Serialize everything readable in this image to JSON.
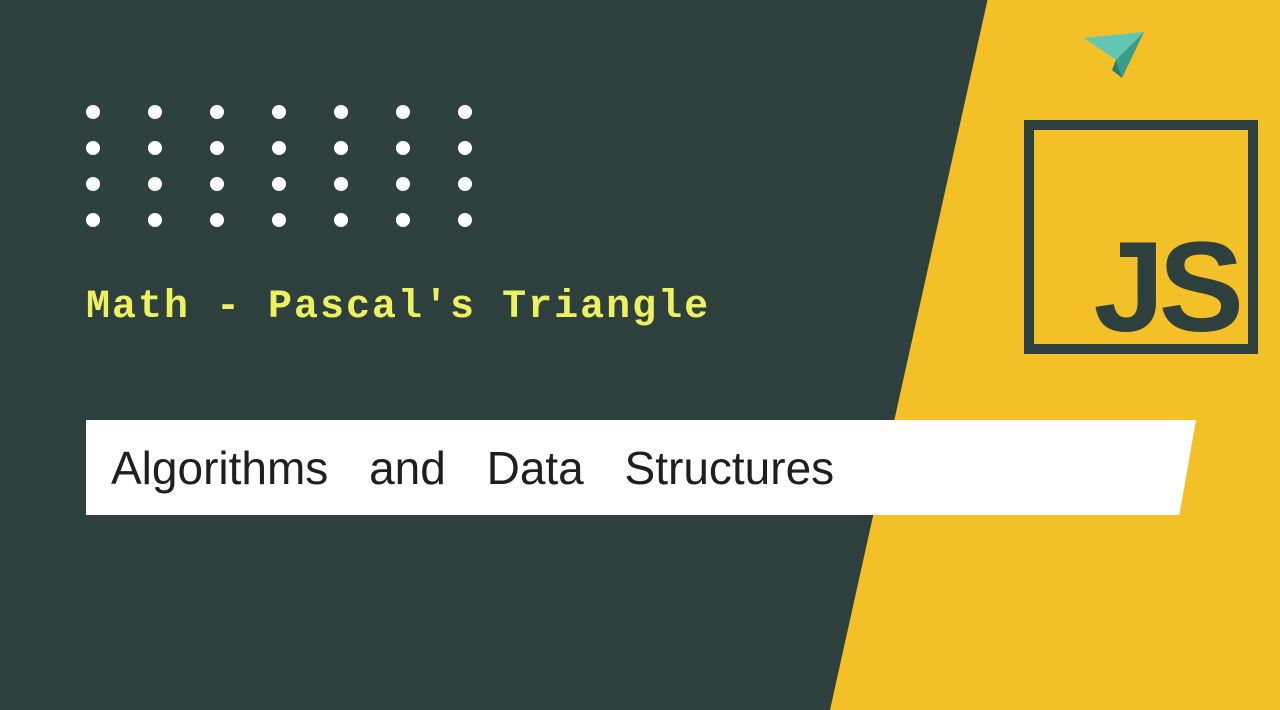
{
  "subtitle": "Math - Pascal's Triangle",
  "title": "Algorithms and Data Structures",
  "logo": {
    "text": "JS"
  },
  "colors": {
    "background": "#2d403e",
    "accent": "#f3c027",
    "subtitle": "#eef15f",
    "banner": "#ffffff",
    "logo_fg": "#2d403e",
    "plane": "#4fb6a3"
  },
  "dots": {
    "rows": 4,
    "cols": 7
  }
}
